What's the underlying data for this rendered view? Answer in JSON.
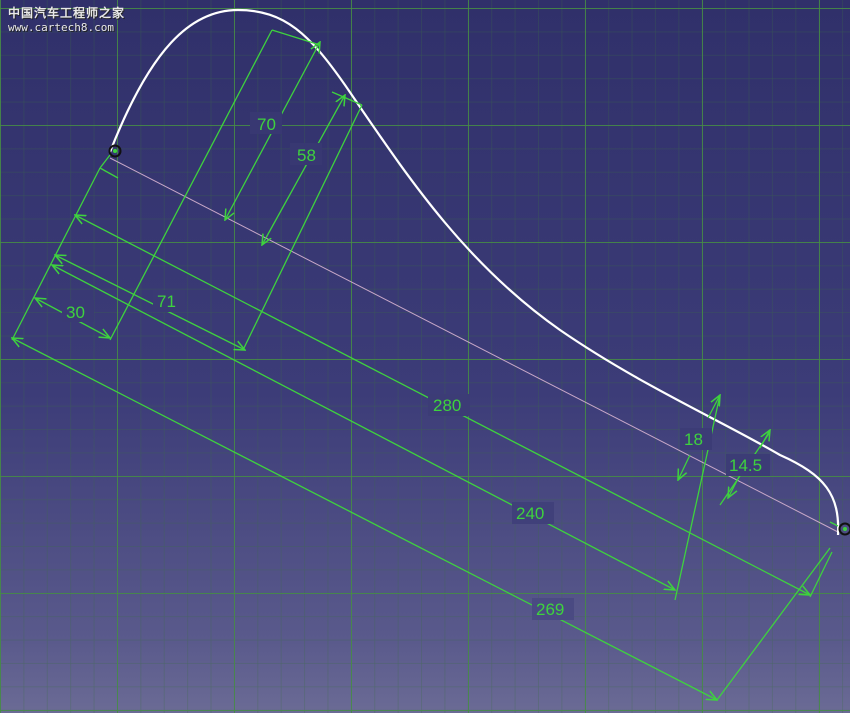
{
  "watermark": {
    "title": "中国汽车工程师之家",
    "url": "www.cartech8.com"
  },
  "colors": {
    "background_top": "#30306a",
    "background_bottom": "#6b6b95",
    "grid": "#468c46",
    "dimension": "#3ed23e",
    "profile_curve": "#ffffff",
    "reference_line": "#c8a8c8"
  },
  "dimensions": [
    {
      "id": "dim-70",
      "label": "70"
    },
    {
      "id": "dim-58",
      "label": "58"
    },
    {
      "id": "dim-71",
      "label": "71"
    },
    {
      "id": "dim-30",
      "label": "30"
    },
    {
      "id": "dim-280",
      "label": "280"
    },
    {
      "id": "dim-18",
      "label": "18"
    },
    {
      "id": "dim-14-5",
      "label": "14.5"
    },
    {
      "id": "dim-240",
      "label": "240"
    },
    {
      "id": "dim-269",
      "label": "269"
    }
  ],
  "icons": {
    "endpoint": "constraint-point-icon"
  }
}
